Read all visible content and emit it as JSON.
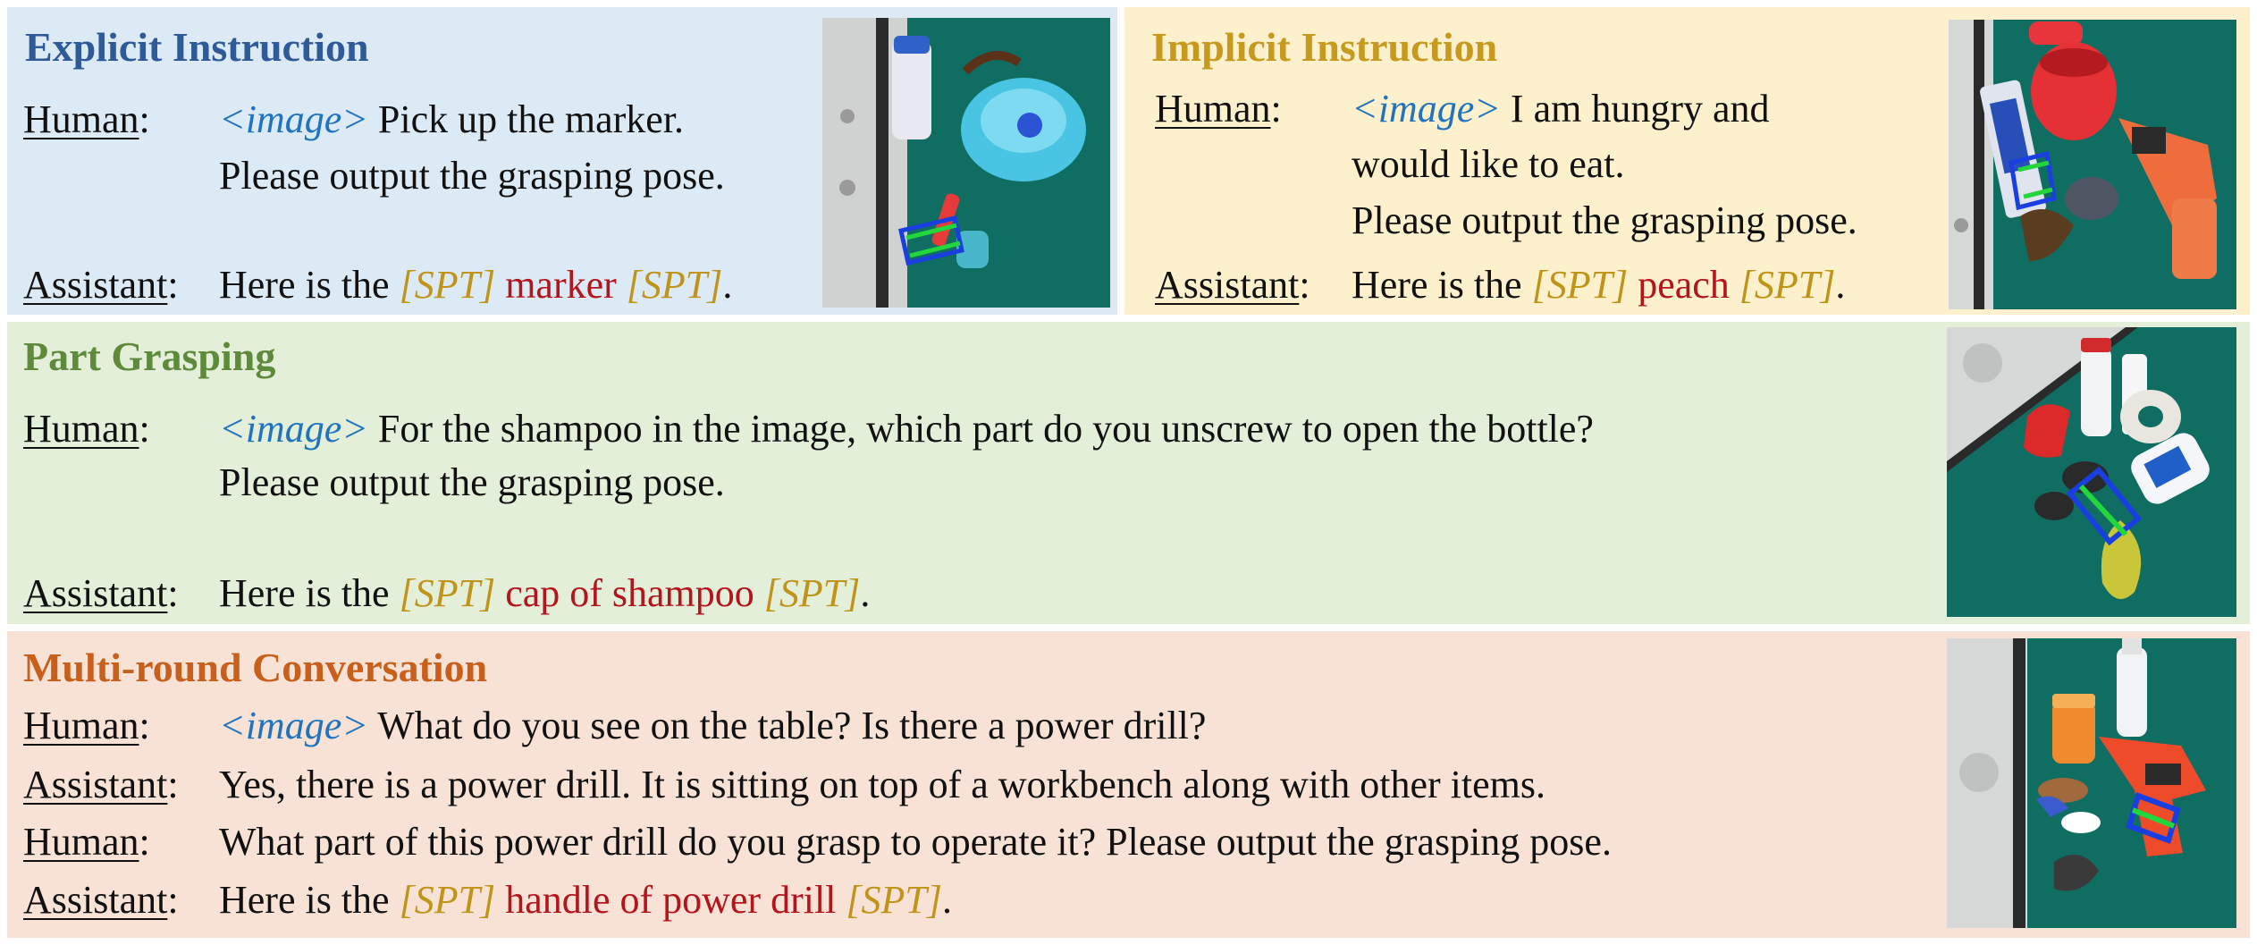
{
  "explicit": {
    "heading": "Explicit Instruction",
    "human_role": "Human",
    "human_image_token": "<image>",
    "human_line1": " Pick up the marker.",
    "human_line2": "Please output the grasping pose.",
    "assistant_role": "Assistant",
    "assistant_prefix": "Here is the ",
    "spt_open": "[SPT]",
    "target": " marker ",
    "spt_close": "[SPT]",
    "suffix": "."
  },
  "implicit": {
    "heading": "Implicit Instruction",
    "human_role": "Human",
    "human_image_token": "<image>",
    "human_line1": " I am hungry and",
    "human_line2": "would like to eat.",
    "human_line3": "Please output the grasping pose.",
    "assistant_role": "Assistant",
    "assistant_prefix": "Here is the ",
    "spt_open": "[SPT]",
    "target": " peach ",
    "spt_close": "[SPT]",
    "suffix": "."
  },
  "part": {
    "heading": "Part Grasping",
    "human_role": "Human",
    "human_image_token": "<image>",
    "human_line1": " For the shampoo in the image, which part do you unscrew to open the bottle?",
    "human_line2": "Please output the grasping pose.",
    "assistant_role": "Assistant",
    "assistant_prefix": "Here is the ",
    "spt_open": "[SPT]",
    "target": " cap of shampoo ",
    "spt_close": "[SPT]",
    "suffix": "."
  },
  "multi": {
    "heading": "Multi-round Conversation",
    "turn1_role": "Human",
    "turn1_image_token": "<image>",
    "turn1_text": " What do you see on the table? Is there a power drill?",
    "turn2_role": "Assistant",
    "turn2_text": "Yes, there is a power drill. It is sitting on top of a workbench along with other items.",
    "turn3_role": "Human",
    "turn3_text": "What part of this power drill do you grasp to operate it? Please output the grasping pose.",
    "turn4_role": "Assistant",
    "turn4_prefix": "Here is the ",
    "spt_open": "[SPT]",
    "target": " handle of power drill ",
    "spt_close": "[SPT]",
    "suffix": "."
  },
  "colors": {
    "explicit_bg": "#dceaf6",
    "implicit_bg": "#fdf0cc",
    "part_bg": "#e3efd9",
    "multi_bg": "#f8e2d6",
    "image_token": "#1f73bf",
    "spt_token": "#c09319",
    "target_text": "#b4141b",
    "table_green": "#0f6d62",
    "grasp_box_blue": "#1a3fe0",
    "grasp_box_green": "#22d63c"
  },
  "icons": [
    "marker-scene-photo",
    "peach-scene-photo",
    "shampoo-scene-photo",
    "drill-scene-photo"
  ]
}
